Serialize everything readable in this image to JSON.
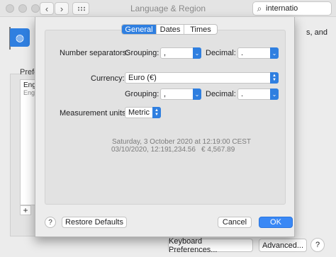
{
  "window": {
    "title": "Language & Region",
    "search_value": "internatio",
    "back_glyph": "‹",
    "forward_glyph": "›"
  },
  "background": {
    "right_text": "s, and",
    "preferred_label": "Prefe",
    "list_item_1": "Eng",
    "list_item_2": "Eng",
    "add_glyph": "+",
    "keyboard_prefs_label": "Keyboard Preferences...",
    "advanced_label": "Advanced...",
    "help_glyph": "?"
  },
  "sheet": {
    "tabs": [
      "General",
      "Dates",
      "Times"
    ],
    "active_tab": "General",
    "number_separators_label": "Number separators:",
    "grouping_label": "Grouping:",
    "decimal_label": "Decimal:",
    "grouping_value": ",",
    "decimal_value": ".",
    "currency_label": "Currency:",
    "currency_value": "Euro (€)",
    "currency_grouping_label": "Grouping:",
    "currency_grouping_value": ",",
    "currency_decimal_label": "Decimal:",
    "currency_decimal_value": ".",
    "measurement_label": "Measurement units:",
    "measurement_value": "Metric",
    "preview_line1": "Saturday, 3 October 2020 at 12:19:00 CEST",
    "preview_line2_date": "03/10/2020, 12:19",
    "preview_line2_number": "1,234.56",
    "preview_line2_currency": "€ 4,567.89",
    "help_glyph": "?",
    "restore_defaults_label": "Restore Defaults",
    "cancel_label": "Cancel",
    "ok_label": "OK"
  },
  "colors": {
    "accent": "#2f7fe0",
    "primary_button": "#3a88f5"
  }
}
